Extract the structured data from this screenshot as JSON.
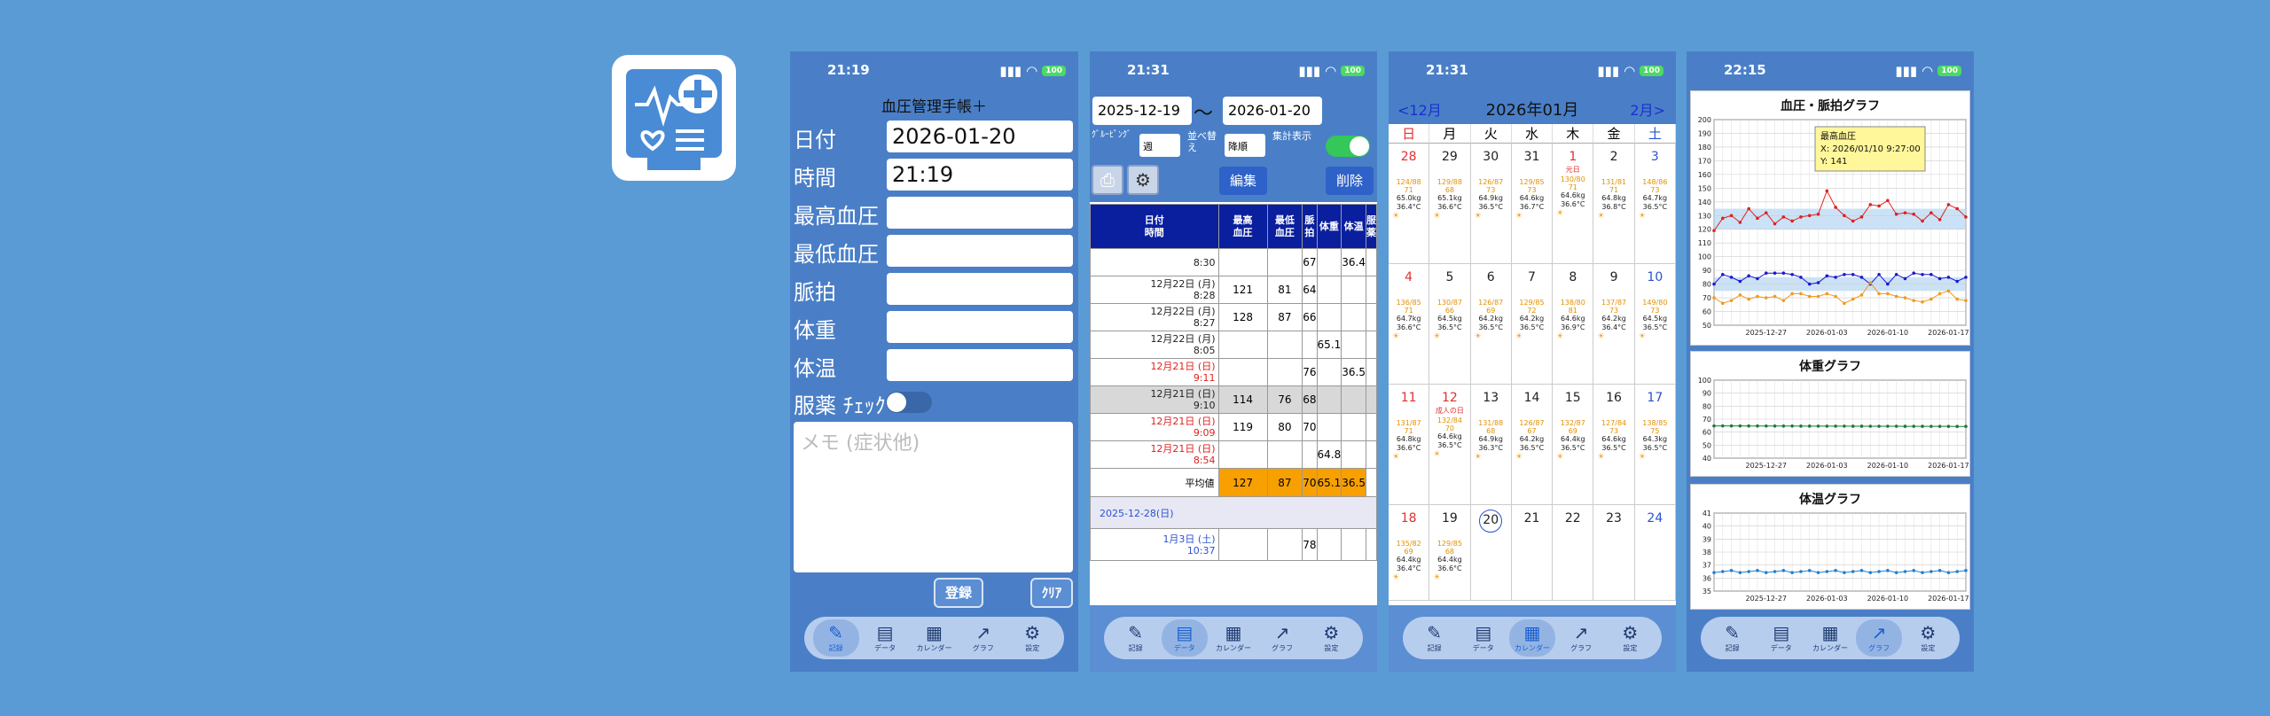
{
  "status": {
    "time1": "21:19",
    "time2": "21:31",
    "time3": "21:31",
    "time4": "22:15",
    "battery": "100"
  },
  "tabs": [
    "記録",
    "データ",
    "カレンダー",
    "グラフ",
    "設定"
  ],
  "entry": {
    "title": "血圧管理手帳＋",
    "date_label": "日付",
    "date_value": "2026-01-20",
    "time_label": "時間",
    "time_value": "21:19",
    "sys_label": "最高血圧",
    "dia_label": "最低血圧",
    "pulse_label": "脈拍",
    "weight_label": "体重",
    "temp_label": "体温",
    "med_label": "服薬 ﾁｪｯｸ",
    "memo_placeholder": "メモ (症状他)",
    "register": "登録",
    "clear": "ｸﾘｱ"
  },
  "data_view": {
    "from": "2025-12-19",
    "tilde": "〜",
    "to": "2026-01-20",
    "group_label": "ｸﾞﾙｰﾋﾟﾝｸﾞ",
    "group_value": "週",
    "sort_label": "並べ替え",
    "sort_value": "降順",
    "summary_label": "集計表示",
    "edit": "編集",
    "delete": "削除",
    "headers": [
      "日付\n時間",
      "最高\n血圧",
      "最低\n血圧",
      "脈拍",
      "体重",
      "体温",
      "服薬"
    ],
    "rows": [
      {
        "d": "",
        "t": "8:30",
        "sys": "",
        "dia": "",
        "pulse": "67",
        "w": "",
        "temp": "36.4",
        "red": false,
        "gray": false
      },
      {
        "d": "12月22日 (月)",
        "t": "8:28",
        "sys": "121",
        "dia": "81",
        "pulse": "64",
        "w": "",
        "temp": "",
        "red": false,
        "gray": false
      },
      {
        "d": "12月22日 (月)",
        "t": "8:27",
        "sys": "128",
        "dia": "87",
        "pulse": "66",
        "w": "",
        "temp": "",
        "red": false,
        "gray": false
      },
      {
        "d": "12月22日 (月)",
        "t": "8:05",
        "sys": "",
        "dia": "",
        "pulse": "",
        "w": "65.1",
        "temp": "",
        "red": false,
        "gray": false
      },
      {
        "d": "12月21日 (日)",
        "t": "9:11",
        "sys": "",
        "dia": "",
        "pulse": "76",
        "w": "",
        "temp": "36.5",
        "red": true,
        "gray": false
      },
      {
        "d": "12月21日 (日)",
        "t": "9:10",
        "sys": "114",
        "dia": "76",
        "pulse": "68",
        "w": "",
        "temp": "",
        "red": false,
        "gray": true
      },
      {
        "d": "12月21日 (日)",
        "t": "9:09",
        "sys": "119",
        "dia": "80",
        "pulse": "70",
        "w": "",
        "temp": "",
        "red": true,
        "gray": false
      },
      {
        "d": "12月21日 (日)",
        "t": "8:54",
        "sys": "",
        "dia": "",
        "pulse": "",
        "w": "64.8",
        "temp": "",
        "red": true,
        "gray": false
      }
    ],
    "avg_label": "平均値",
    "avg": [
      "127",
      "87",
      "70",
      "65.1",
      "36.5"
    ],
    "week_header": "2025-12-28(日)",
    "last_row": {
      "d": "1月3日 (土)",
      "t": "10:37",
      "pulse": "78"
    }
  },
  "calendar": {
    "prev": "<12月",
    "title": "2026年01月",
    "next": "2月>",
    "weekdays": [
      "日",
      "月",
      "火",
      "水",
      "木",
      "金",
      "土"
    ],
    "weeks": [
      [
        {
          "n": "28",
          "bp": "124/88",
          "p": "71",
          "w": "65.0kg",
          "t": "36.4°C"
        },
        {
          "n": "29",
          "bp": "129/88",
          "p": "68",
          "w": "65.1kg",
          "t": "36.6°C"
        },
        {
          "n": "30",
          "bp": "126/87",
          "p": "73",
          "w": "64.9kg",
          "t": "36.5°C"
        },
        {
          "n": "31",
          "bp": "129/85",
          "p": "73",
          "w": "64.6kg",
          "t": "36.7°C"
        },
        {
          "n": "1",
          "hol": "元日",
          "bp": "130/80",
          "p": "71",
          "w": "64.6kg",
          "t": "36.6°C"
        },
        {
          "n": "2",
          "bp": "131/81",
          "p": "71",
          "w": "64.8kg",
          "t": "36.8°C"
        },
        {
          "n": "3",
          "bp": "148/86",
          "p": "73",
          "w": "64.7kg",
          "t": "36.5°C"
        }
      ],
      [
        {
          "n": "4",
          "bp": "136/85",
          "p": "71",
          "w": "64.7kg",
          "t": "36.6°C"
        },
        {
          "n": "5",
          "bp": "130/87",
          "p": "66",
          "w": "64.5kg",
          "t": "36.5°C"
        },
        {
          "n": "6",
          "bp": "126/87",
          "p": "69",
          "w": "64.2kg",
          "t": "36.5°C"
        },
        {
          "n": "7",
          "bp": "129/85",
          "p": "72",
          "w": "64.2kg",
          "t": "36.5°C"
        },
        {
          "n": "8",
          "bp": "138/80",
          "p": "81",
          "w": "64.6kg",
          "t": "36.9°C"
        },
        {
          "n": "9",
          "bp": "137/87",
          "p": "73",
          "w": "64.2kg",
          "t": "36.4°C"
        },
        {
          "n": "10",
          "bp": "149/80",
          "p": "73",
          "w": "64.5kg",
          "t": "36.5°C"
        }
      ],
      [
        {
          "n": "11",
          "bp": "131/87",
          "p": "71",
          "w": "64.8kg",
          "t": "36.6°C"
        },
        {
          "n": "12",
          "hol": "成人の日",
          "bp": "132/84",
          "p": "70",
          "w": "64.6kg",
          "t": "36.5°C"
        },
        {
          "n": "13",
          "bp": "131/88",
          "p": "68",
          "w": "64.9kg",
          "t": "36.3°C"
        },
        {
          "n": "14",
          "bp": "126/87",
          "p": "67",
          "w": "64.2kg",
          "t": "36.5°C"
        },
        {
          "n": "15",
          "bp": "132/87",
          "p": "69",
          "w": "64.4kg",
          "t": "36.5°C"
        },
        {
          "n": "16",
          "bp": "127/84",
          "p": "73",
          "w": "64.6kg",
          "t": "36.5°C"
        },
        {
          "n": "17",
          "bp": "138/85",
          "p": "75",
          "w": "64.3kg",
          "t": "36.5°C"
        }
      ],
      [
        {
          "n": "18",
          "bp": "135/82",
          "p": "69",
          "w": "64.4kg",
          "t": "36.4°C"
        },
        {
          "n": "19",
          "bp": "129/85",
          "p": "68",
          "w": "64.4kg",
          "t": "36.6°C"
        },
        {
          "n": "20"
        },
        {
          "n": "21"
        },
        {
          "n": "22"
        },
        {
          "n": "23"
        },
        {
          "n": "24"
        }
      ]
    ]
  },
  "graphs": {
    "bp_title": "血圧・脈拍グラフ",
    "tooltip": [
      "最高血圧",
      "X: 2026/01/10 9:27:00",
      "Y: 141"
    ],
    "xticks": [
      "2025-12-27",
      "2026-01-03",
      "2026-01-10",
      "2026-01-17"
    ],
    "bp_yticks": [
      "200",
      "190",
      "180",
      "170",
      "160",
      "150",
      "140",
      "130",
      "120",
      "110",
      "100",
      "90",
      "80",
      "70",
      "60",
      "50"
    ],
    "w_title": "体重グラフ",
    "w_yticks": [
      "100",
      "90",
      "80",
      "70",
      "60",
      "50",
      "40"
    ],
    "t_title": "体温グラフ",
    "t_yticks": [
      "41",
      "40",
      "39",
      "38",
      "37",
      "36",
      "35"
    ]
  },
  "chart_data": [
    {
      "type": "line",
      "title": "血圧・脈拍グラフ",
      "ylim": [
        50,
        200
      ],
      "x": [
        "2025-12-21",
        "2025-12-22",
        "2025-12-23",
        "2025-12-24",
        "2025-12-25",
        "2025-12-26",
        "2025-12-27",
        "2025-12-28",
        "2025-12-29",
        "2025-12-30",
        "2025-12-31",
        "2026-01-01",
        "2026-01-02",
        "2026-01-03",
        "2026-01-04",
        "2026-01-05",
        "2026-01-06",
        "2026-01-07",
        "2026-01-08",
        "2026-01-09",
        "2026-01-10",
        "2026-01-11",
        "2026-01-12",
        "2026-01-13",
        "2026-01-14",
        "2026-01-15",
        "2026-01-16",
        "2026-01-17",
        "2026-01-18",
        "2026-01-19"
      ],
      "series": [
        {
          "values": [
            119,
            128,
            130,
            125,
            135,
            128,
            132,
            124,
            129,
            126,
            129,
            130,
            131,
            148,
            136,
            130,
            126,
            129,
            138,
            137,
            141,
            131,
            132,
            131,
            126,
            132,
            127,
            138,
            135,
            129
          ],
          "color": "#e02020"
        },
        {
          "values": [
            80,
            87,
            85,
            82,
            86,
            84,
            88,
            88,
            88,
            87,
            85,
            80,
            81,
            86,
            85,
            87,
            87,
            85,
            80,
            87,
            80,
            87,
            84,
            88,
            87,
            87,
            84,
            85,
            82,
            85
          ],
          "color": "#1a1ad0"
        },
        {
          "values": [
            70,
            66,
            68,
            72,
            69,
            71,
            70,
            71,
            68,
            73,
            73,
            71,
            71,
            73,
            71,
            66,
            69,
            72,
            81,
            73,
            73,
            71,
            70,
            68,
            67,
            69,
            73,
            75,
            69,
            68
          ],
          "color": "#f09a20"
        }
      ]
    },
    {
      "type": "line",
      "title": "体重グラフ",
      "ylim": [
        40,
        100
      ],
      "x": [
        "2025-12-21",
        "2026-01-19"
      ],
      "series": [
        {
          "values": [
            64.8,
            64.4
          ],
          "color": "#1a7a3a"
        }
      ]
    },
    {
      "type": "line",
      "title": "体温グラフ",
      "ylim": [
        35,
        41
      ],
      "x": [
        "2025-12-21",
        "2026-01-19"
      ],
      "series": [
        {
          "values": [
            36.5,
            36.6
          ],
          "color": "#2080d0"
        }
      ]
    }
  ]
}
